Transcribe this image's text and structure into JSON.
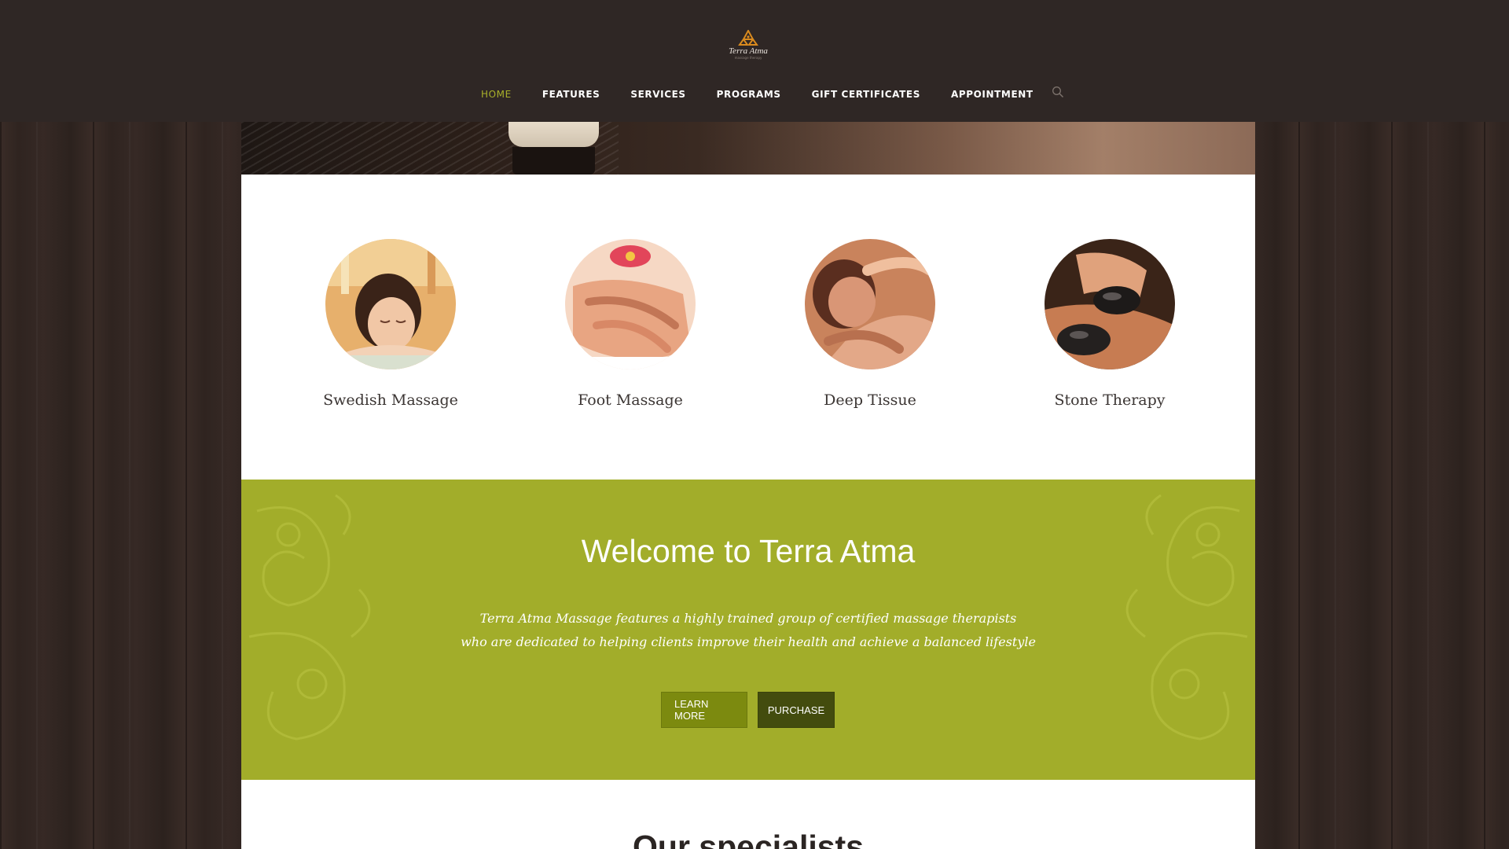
{
  "brand": {
    "name": "Terra Atma",
    "tagline": "massage therapy",
    "accent": "#a8b02a"
  },
  "nav": {
    "items": [
      {
        "label": "HOME",
        "active": true
      },
      {
        "label": "FEATURES",
        "active": false
      },
      {
        "label": "SERVICES",
        "active": false
      },
      {
        "label": "PROGRAMS",
        "active": false
      },
      {
        "label": "GIFT CERTIFICATES",
        "active": false
      },
      {
        "label": "APPOINTMENT",
        "active": false
      }
    ],
    "search_icon": "search-icon"
  },
  "services": [
    {
      "label": "Swedish Massage"
    },
    {
      "label": "Foot Massage"
    },
    {
      "label": "Deep Tissue"
    },
    {
      "label": "Stone Therapy"
    }
  ],
  "welcome": {
    "title": "Welcome to Terra Atma",
    "line1": "Terra Atma Massage features a highly trained group of certified massage therapists",
    "line2": "who are dedicated to helping clients improve their health and achieve a balanced lifestyle",
    "learn_more": "LEARN MORE",
    "purchase": "PURCHASE",
    "background": "#a2ad2a"
  },
  "specialists": {
    "title": "Our specialists"
  }
}
